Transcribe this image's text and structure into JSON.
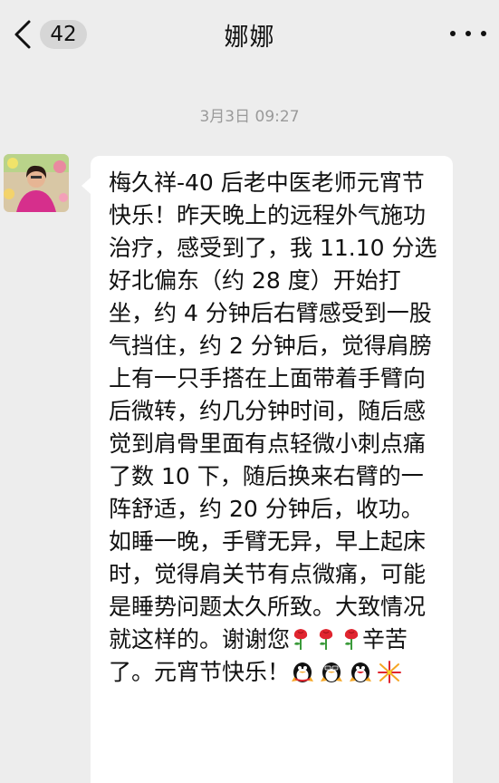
{
  "header": {
    "unread_count": "42",
    "title": "娜娜",
    "back_icon": "chevron-left-icon",
    "more_icon": "more-horizontal-icon"
  },
  "chat": {
    "timestamp": "3月3日 09:27",
    "message": {
      "sender_avatar": "avatar-photo",
      "text_main": "梅久祥-40 后老中医老师元宵节快乐！昨天晚上的远程外气施功治疗，感受到了，我 11.10 分选好北偏东（约 28 度）开始打坐，约 4 分钟后右臂感受到一股气挡住，约 2 分钟后，觉得肩膀上有一只手搭在上面带着手臂向后微转，约几分钟时间，随后感觉到肩骨里面有点轻微小刺点痛了数 10 下，随后换来右臂的一阵舒适，约 20 分钟后，收功。如睡一晚，手臂无异，早上起床时，觉得肩关节有点微痛，可能是睡势问题太久所致。大致情况就这样的。谢谢您",
      "text_mid": "辛苦了。元宵节快乐！",
      "inline_emojis_1": [
        "rose-emoji",
        "rose-emoji",
        "rose-emoji"
      ],
      "inline_emojis_2": [
        "qq-penguin-emoji",
        "qq-penguin-emoji",
        "qq-penguin-emoji",
        "firework-emoji"
      ]
    }
  },
  "colors": {
    "background": "#ededed",
    "bubble": "#ffffff",
    "badge": "#d6d6d6",
    "timestamp": "#9a9a9a"
  }
}
